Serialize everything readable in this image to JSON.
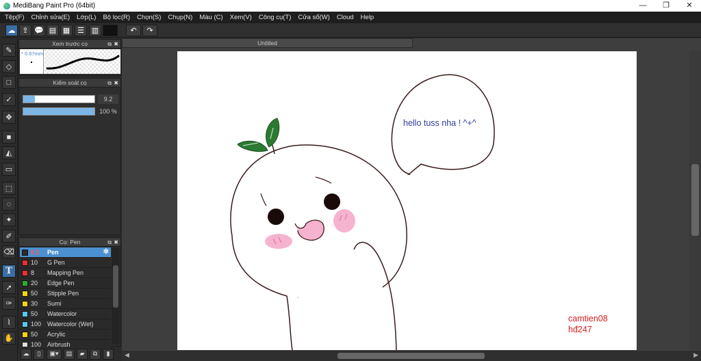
{
  "window": {
    "title": "MediBang Paint Pro (64bit)",
    "minimize": "—",
    "restore": "❐",
    "close": "✕"
  },
  "menu": [
    "Tệp(F)",
    "Chỉnh sửa(E)",
    "Lớp(L)",
    "Bộ lọc(R)",
    "Chọn(S)",
    "Chụp(N)",
    "Màu (C)",
    "Xem(V)",
    "Công cụ(T)",
    "Cửa sổ(W)",
    "Cloud",
    "Help"
  ],
  "toolbar": {
    "undo": "↶",
    "redo": "↷"
  },
  "panels": {
    "brush_preview": {
      "title": "Xem trước cọ",
      "size": "* 0.67mm"
    },
    "brush_control": {
      "title": "Kiểm soát cọ",
      "size_value": "9.2",
      "size_fraction": 0.16,
      "opacity_value": "100 %",
      "opacity_fraction": 1.0
    },
    "brush_list": {
      "title": "Cọ: Pen",
      "items": [
        {
          "size": "9.2",
          "name": "Pen",
          "color": "#2a2a2a",
          "selected": true
        },
        {
          "size": "10",
          "name": "G Pen",
          "color": "#e53030"
        },
        {
          "size": "8",
          "name": "Mapping Pen",
          "color": "#e53030"
        },
        {
          "size": "20",
          "name": "Edge Pen",
          "color": "#2fa82f"
        },
        {
          "size": "50",
          "name": "Stipple Pen",
          "color": "#f2d21a"
        },
        {
          "size": "30",
          "name": "Sumi",
          "color": "#f2d21a"
        },
        {
          "size": "50",
          "name": "Watercolor",
          "color": "#5bc6ee"
        },
        {
          "size": "100",
          "name": "Watercolor (Wet)",
          "color": "#5bc6ee"
        },
        {
          "size": "50",
          "name": "Acrylic",
          "color": "#f2d21a"
        },
        {
          "size": "100",
          "name": "Airbrush",
          "color": "#dddddd"
        }
      ]
    }
  },
  "document": {
    "tab_title": "Untitled"
  },
  "canvas": {
    "bubble_text": "hello tuss nha ! ^+^",
    "signature_line1": "camtien08",
    "signature_line2": "hđ247"
  }
}
